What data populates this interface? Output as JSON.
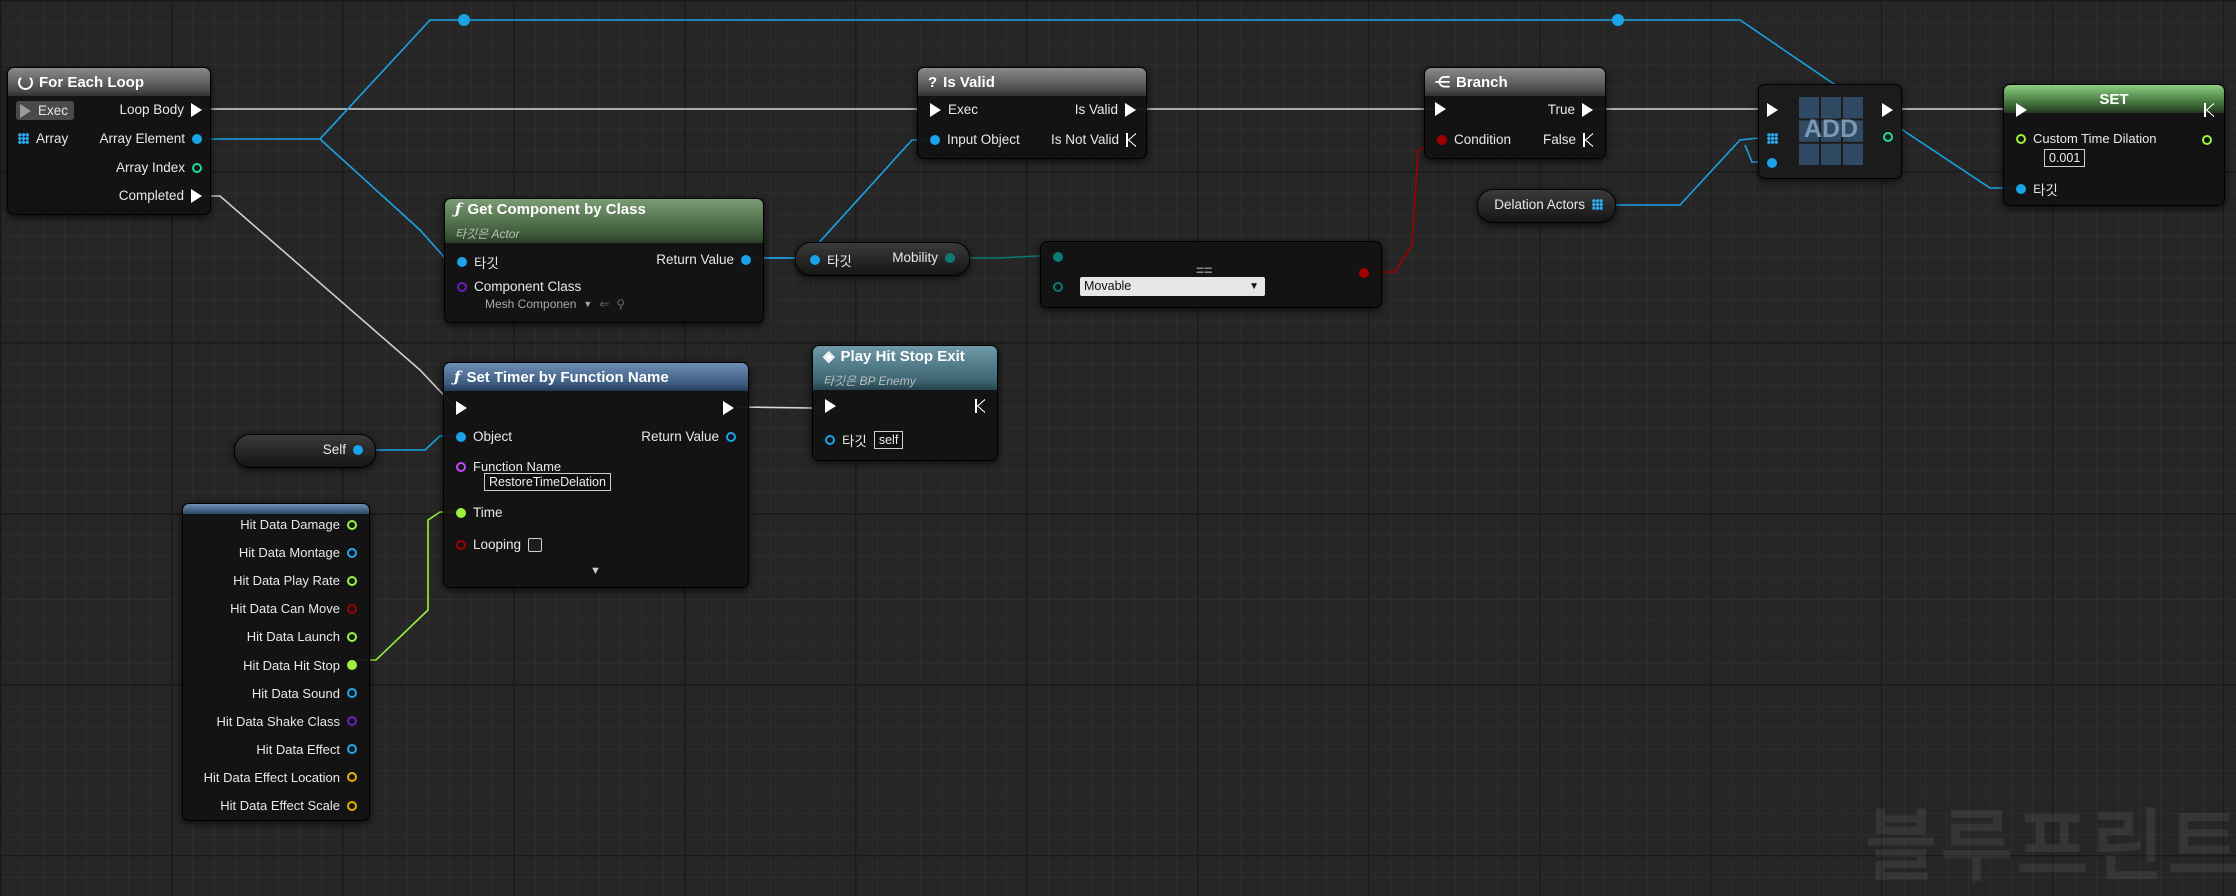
{
  "watermark": "블루프린트",
  "colors": {
    "exec": "#ffffff",
    "object": "#1fa9ef",
    "float": "#9cf23c",
    "bool": "#a00000",
    "name": "#c64aff",
    "byte": "#0a7a72",
    "class": "#6a1fbf",
    "struct": "#e0b000",
    "int": "#1edc9a"
  },
  "foreach": {
    "title": "For Each Loop",
    "icon": "loop-icon",
    "pin_exec": "Exec",
    "pin_array": "Array",
    "pin_loop_body": "Loop Body",
    "pin_array_element": "Array Element",
    "pin_array_index": "Array Index",
    "pin_completed": "Completed"
  },
  "getcomp": {
    "title": "Get Component by Class",
    "subtitle": "타깃은 Actor",
    "icon": "function-icon",
    "pin_target": "타깃",
    "pin_return": "Return Value",
    "pin_class": "Component Class",
    "class_value": "Mesh Componen"
  },
  "mobility": {
    "pin_target": "타깃",
    "pin_mobility": "Mobility"
  },
  "equal": {
    "symbol": "==",
    "enum_value": "Movable"
  },
  "isvalid": {
    "title": "Is Valid",
    "icon": "question-icon",
    "pin_exec": "Exec",
    "pin_input": "Input Object",
    "pin_is_valid": "Is Valid",
    "pin_not_valid": "Is Not Valid"
  },
  "branch": {
    "title": "Branch",
    "icon": "branch-icon",
    "pin_condition": "Condition",
    "pin_true": "True",
    "pin_false": "False"
  },
  "add": {
    "label": "ADD"
  },
  "delation": {
    "label": "Delation Actors"
  },
  "setnode": {
    "title": "SET",
    "pin_dilation": "Custom Time Dilation",
    "dilation_value": "0.001",
    "pin_target": "타깃"
  },
  "settimer": {
    "title": "Set Timer by Function Name",
    "icon": "function-icon",
    "pin_object": "Object",
    "pin_return": "Return Value",
    "pin_funcname": "Function Name",
    "funcname_value": "RestoreTimeDelation",
    "pin_time": "Time",
    "pin_looping": "Looping",
    "looping": false
  },
  "self": {
    "label": "Self"
  },
  "hitstop": {
    "title": "Play Hit Stop Exit",
    "subtitle": "타깃은 BP Enemy",
    "icon": "event-icon",
    "pin_target": "타깃",
    "target_value": "self"
  },
  "hitdata": {
    "fields": [
      {
        "label": "Hit Data Damage",
        "type": "float"
      },
      {
        "label": "Hit Data Montage",
        "type": "object"
      },
      {
        "label": "Hit Data Play Rate",
        "type": "float"
      },
      {
        "label": "Hit Data Can Move",
        "type": "bool"
      },
      {
        "label": "Hit Data Launch",
        "type": "float"
      },
      {
        "label": "Hit Data Hit Stop",
        "type": "float"
      },
      {
        "label": "Hit Data Sound",
        "type": "object"
      },
      {
        "label": "Hit Data Shake Class",
        "type": "class"
      },
      {
        "label": "Hit Data Effect",
        "type": "object"
      },
      {
        "label": "Hit Data Effect Location",
        "type": "struct"
      },
      {
        "label": "Hit Data Effect Scale",
        "type": "struct"
      }
    ]
  }
}
